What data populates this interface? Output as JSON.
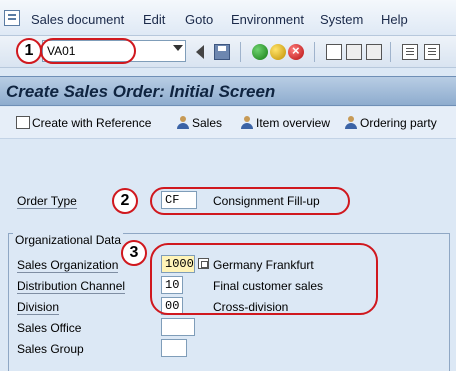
{
  "menu": {
    "items": [
      {
        "label": "Sales document",
        "mnemonic": "S"
      },
      {
        "label": "Edit"
      },
      {
        "label": "Goto"
      },
      {
        "label": "Environment"
      },
      {
        "label": "System"
      },
      {
        "label": "Help"
      }
    ]
  },
  "toolbar": {
    "command_value": "VA01"
  },
  "title": "Create Sales Order: Initial Screen",
  "app_toolbar": {
    "create_with_reference": "Create with Reference",
    "sales": "Sales",
    "item_overview": "Item overview",
    "ordering_party": "Ordering party"
  },
  "form": {
    "order_type_label": "Order Type",
    "order_type_value": "CF",
    "order_type_desc": "Consignment Fill-up",
    "org_group_title": "Organizational Data",
    "sales_org_label": "Sales Organization",
    "sales_org_value": "1000",
    "sales_org_desc": "Germany Frankfurt",
    "dist_channel_label": "Distribution Channel",
    "dist_channel_value": "10",
    "dist_channel_desc": "Final customer sales",
    "division_label": "Division",
    "division_value": "00",
    "division_desc": "Cross-division",
    "sales_office_label": "Sales Office",
    "sales_office_value": "",
    "sales_group_label": "Sales Group",
    "sales_group_value": ""
  },
  "annotations": {
    "one": "1",
    "two": "2",
    "three": "3"
  },
  "colors": {
    "annotation_red": "#d0181e",
    "title_blue": "#8eacce",
    "background": "#dce8f5"
  }
}
